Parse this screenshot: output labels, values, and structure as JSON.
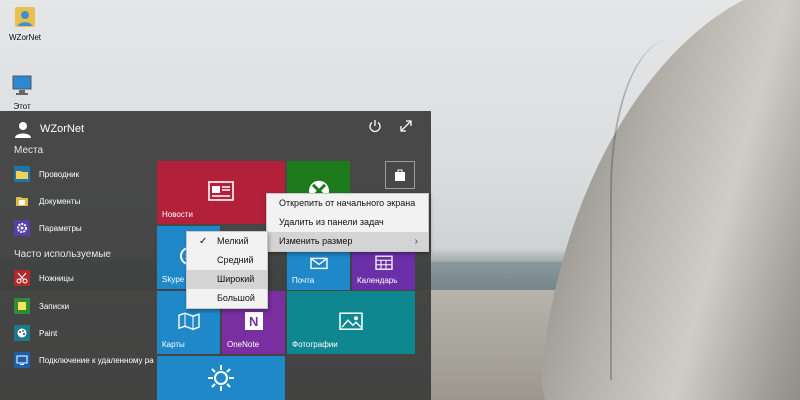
{
  "desktop": {
    "icons": [
      {
        "label": "WZorNet",
        "icon": "user-folder-icon"
      },
      {
        "label": "Этот",
        "icon": "computer-icon"
      }
    ]
  },
  "start_menu": {
    "user_name": "WZorNet",
    "places_header": "Места",
    "places": [
      {
        "label": "Проводник",
        "icon": "folder-icon",
        "color": "#1f74a8"
      },
      {
        "label": "Документы",
        "icon": "documents-icon",
        "color": "#8a6a2a"
      },
      {
        "label": "Параметры",
        "icon": "gear-icon",
        "color": "#5440a8"
      }
    ],
    "frequent_header": "Часто используемые",
    "frequent": [
      {
        "label": "Ножницы",
        "icon": "scissors-icon",
        "color": "#b02a2a"
      },
      {
        "label": "Записки",
        "icon": "sticky-notes-icon",
        "color": "#2f8a3a"
      },
      {
        "label": "Paint",
        "icon": "paint-icon",
        "color": "#1a7a8a"
      },
      {
        "label": "Подключение к удаленному ра",
        "icon": "remote-desktop-icon",
        "color": "#1f5fa8"
      }
    ],
    "tiles": {
      "news": "Новости",
      "skype": "Skype",
      "mail": "Почта",
      "calendar": "Календарь",
      "maps": "Карты",
      "onenote": "OneNote",
      "photos": "Фотографии"
    },
    "colors": {
      "news": "#b3203a",
      "xbox": "#1d7b1d",
      "blue": "#1f88c9",
      "purple": "#6b2fa8",
      "teal": "#0f8790",
      "onenote_purple": "#7a2fa0"
    }
  },
  "context_menu": {
    "items": [
      "Открепить от начального экрана",
      "Удалить из панели задач",
      "Изменить размер"
    ],
    "submenu_arrow": "›"
  },
  "size_submenu": {
    "items": [
      "Мелкий",
      "Средний",
      "Широкий",
      "Большой"
    ],
    "checked": "Мелкий",
    "check_glyph": "✓"
  }
}
